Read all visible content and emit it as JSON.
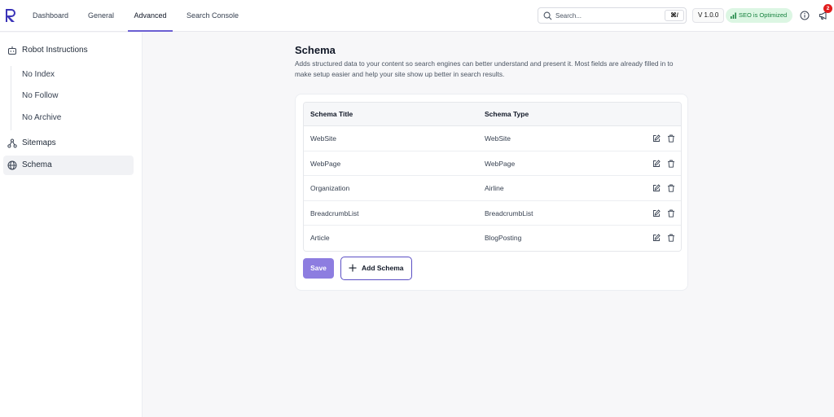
{
  "nav": {
    "tabs": [
      {
        "label": "Dashboard"
      },
      {
        "label": "General"
      },
      {
        "label": "Advanced"
      },
      {
        "label": "Search Console"
      }
    ],
    "active_tab": "Advanced"
  },
  "header": {
    "search": {
      "placeholder": "Search...",
      "shortcut": "⌘/"
    },
    "version": "V 1.0.0",
    "seo_status": "SEO is Optimized",
    "notification_count": "2"
  },
  "sidebar": {
    "robot_instructions": {
      "label": "Robot Instructions",
      "items": [
        {
          "label": "No Index"
        },
        {
          "label": "No Follow"
        },
        {
          "label": "No Archive"
        }
      ]
    },
    "sitemaps": {
      "label": "Sitemaps"
    },
    "schema": {
      "label": "Schema"
    }
  },
  "main": {
    "title": "Schema",
    "description": "Adds structured data to your content so search engines can better understand and present it. Most fields are already filled in to make setup easier and help your site show up better in search results.",
    "table": {
      "columns": [
        "Schema Title",
        "Schema Type"
      ],
      "rows": [
        {
          "title": "WebSite",
          "type": "WebSite"
        },
        {
          "title": "WebPage",
          "type": "WebPage"
        },
        {
          "title": "Organization",
          "type": "Airline"
        },
        {
          "title": "BreadcrumbList",
          "type": "BreadcrumbList"
        },
        {
          "title": "Article",
          "type": "BlogPosting"
        }
      ]
    },
    "buttons": {
      "save": "Save",
      "add_schema": "Add Schema"
    }
  },
  "colors": {
    "accent": "#6b5fd3",
    "save_button": "#8d7de0",
    "seo_badge_bg": "#dcf6e3",
    "seo_badge_text": "#15803d",
    "notification": "#e11d1d"
  }
}
